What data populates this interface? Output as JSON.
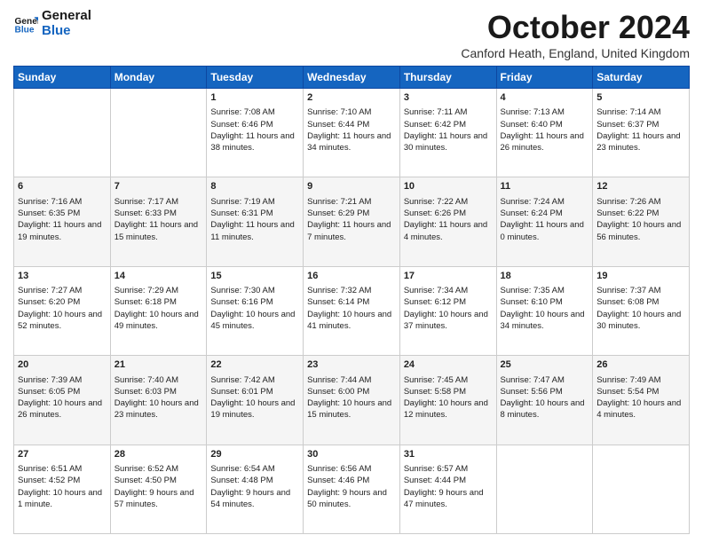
{
  "header": {
    "logo_line1": "General",
    "logo_line2": "Blue",
    "month": "October 2024",
    "location": "Canford Heath, England, United Kingdom"
  },
  "weekdays": [
    "Sunday",
    "Monday",
    "Tuesday",
    "Wednesday",
    "Thursday",
    "Friday",
    "Saturday"
  ],
  "weeks": [
    [
      {
        "day": "",
        "content": ""
      },
      {
        "day": "",
        "content": ""
      },
      {
        "day": "1",
        "content": "Sunrise: 7:08 AM\nSunset: 6:46 PM\nDaylight: 11 hours and 38 minutes."
      },
      {
        "day": "2",
        "content": "Sunrise: 7:10 AM\nSunset: 6:44 PM\nDaylight: 11 hours and 34 minutes."
      },
      {
        "day": "3",
        "content": "Sunrise: 7:11 AM\nSunset: 6:42 PM\nDaylight: 11 hours and 30 minutes."
      },
      {
        "day": "4",
        "content": "Sunrise: 7:13 AM\nSunset: 6:40 PM\nDaylight: 11 hours and 26 minutes."
      },
      {
        "day": "5",
        "content": "Sunrise: 7:14 AM\nSunset: 6:37 PM\nDaylight: 11 hours and 23 minutes."
      }
    ],
    [
      {
        "day": "6",
        "content": "Sunrise: 7:16 AM\nSunset: 6:35 PM\nDaylight: 11 hours and 19 minutes."
      },
      {
        "day": "7",
        "content": "Sunrise: 7:17 AM\nSunset: 6:33 PM\nDaylight: 11 hours and 15 minutes."
      },
      {
        "day": "8",
        "content": "Sunrise: 7:19 AM\nSunset: 6:31 PM\nDaylight: 11 hours and 11 minutes."
      },
      {
        "day": "9",
        "content": "Sunrise: 7:21 AM\nSunset: 6:29 PM\nDaylight: 11 hours and 7 minutes."
      },
      {
        "day": "10",
        "content": "Sunrise: 7:22 AM\nSunset: 6:26 PM\nDaylight: 11 hours and 4 minutes."
      },
      {
        "day": "11",
        "content": "Sunrise: 7:24 AM\nSunset: 6:24 PM\nDaylight: 11 hours and 0 minutes."
      },
      {
        "day": "12",
        "content": "Sunrise: 7:26 AM\nSunset: 6:22 PM\nDaylight: 10 hours and 56 minutes."
      }
    ],
    [
      {
        "day": "13",
        "content": "Sunrise: 7:27 AM\nSunset: 6:20 PM\nDaylight: 10 hours and 52 minutes."
      },
      {
        "day": "14",
        "content": "Sunrise: 7:29 AM\nSunset: 6:18 PM\nDaylight: 10 hours and 49 minutes."
      },
      {
        "day": "15",
        "content": "Sunrise: 7:30 AM\nSunset: 6:16 PM\nDaylight: 10 hours and 45 minutes."
      },
      {
        "day": "16",
        "content": "Sunrise: 7:32 AM\nSunset: 6:14 PM\nDaylight: 10 hours and 41 minutes."
      },
      {
        "day": "17",
        "content": "Sunrise: 7:34 AM\nSunset: 6:12 PM\nDaylight: 10 hours and 37 minutes."
      },
      {
        "day": "18",
        "content": "Sunrise: 7:35 AM\nSunset: 6:10 PM\nDaylight: 10 hours and 34 minutes."
      },
      {
        "day": "19",
        "content": "Sunrise: 7:37 AM\nSunset: 6:08 PM\nDaylight: 10 hours and 30 minutes."
      }
    ],
    [
      {
        "day": "20",
        "content": "Sunrise: 7:39 AM\nSunset: 6:05 PM\nDaylight: 10 hours and 26 minutes."
      },
      {
        "day": "21",
        "content": "Sunrise: 7:40 AM\nSunset: 6:03 PM\nDaylight: 10 hours and 23 minutes."
      },
      {
        "day": "22",
        "content": "Sunrise: 7:42 AM\nSunset: 6:01 PM\nDaylight: 10 hours and 19 minutes."
      },
      {
        "day": "23",
        "content": "Sunrise: 7:44 AM\nSunset: 6:00 PM\nDaylight: 10 hours and 15 minutes."
      },
      {
        "day": "24",
        "content": "Sunrise: 7:45 AM\nSunset: 5:58 PM\nDaylight: 10 hours and 12 minutes."
      },
      {
        "day": "25",
        "content": "Sunrise: 7:47 AM\nSunset: 5:56 PM\nDaylight: 10 hours and 8 minutes."
      },
      {
        "day": "26",
        "content": "Sunrise: 7:49 AM\nSunset: 5:54 PM\nDaylight: 10 hours and 4 minutes."
      }
    ],
    [
      {
        "day": "27",
        "content": "Sunrise: 6:51 AM\nSunset: 4:52 PM\nDaylight: 10 hours and 1 minute."
      },
      {
        "day": "28",
        "content": "Sunrise: 6:52 AM\nSunset: 4:50 PM\nDaylight: 9 hours and 57 minutes."
      },
      {
        "day": "29",
        "content": "Sunrise: 6:54 AM\nSunset: 4:48 PM\nDaylight: 9 hours and 54 minutes."
      },
      {
        "day": "30",
        "content": "Sunrise: 6:56 AM\nSunset: 4:46 PM\nDaylight: 9 hours and 50 minutes."
      },
      {
        "day": "31",
        "content": "Sunrise: 6:57 AM\nSunset: 4:44 PM\nDaylight: 9 hours and 47 minutes."
      },
      {
        "day": "",
        "content": ""
      },
      {
        "day": "",
        "content": ""
      }
    ]
  ]
}
